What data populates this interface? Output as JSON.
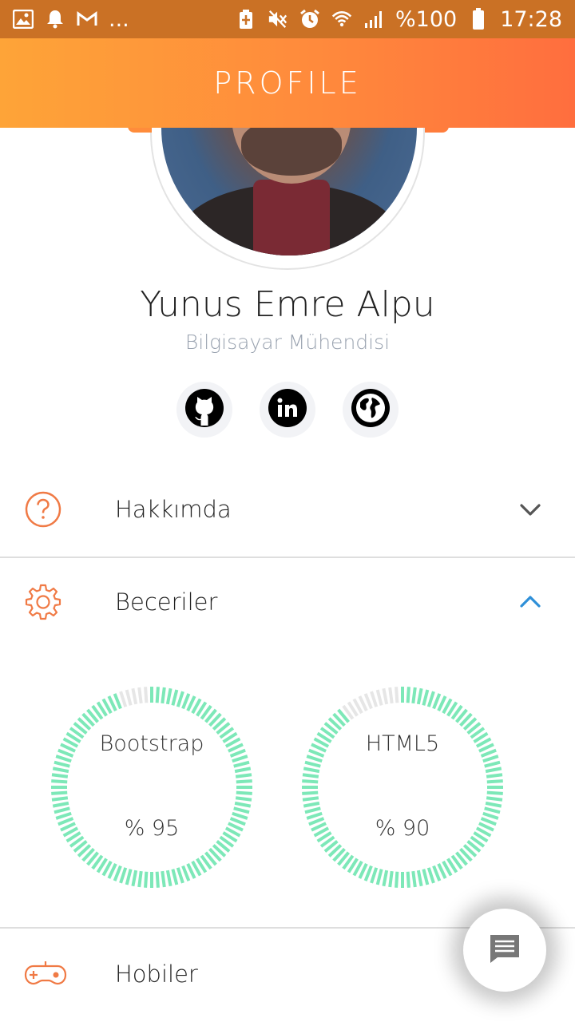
{
  "status_bar": {
    "battery_text": "%100",
    "time": "17:28",
    "left_icons": [
      "image-icon",
      "bell-icon",
      "gmail-icon",
      "more-dots-icon"
    ],
    "right_icons": [
      "battery-saver-icon",
      "mute-icon",
      "alarm-icon",
      "wifi-icon",
      "signal-icon",
      "battery-icon"
    ],
    "more_text": "..."
  },
  "header": {
    "title": "PROFILE"
  },
  "profile": {
    "name": "Yunus Emre Alpu",
    "title": "Bilgisayar Mühendisi"
  },
  "social": [
    {
      "name": "github-icon"
    },
    {
      "name": "linkedin-icon"
    },
    {
      "name": "globe-icon"
    }
  ],
  "sections": {
    "about": {
      "label": "Hakkımda",
      "expanded": false
    },
    "skills": {
      "label": "Beceriler",
      "expanded": true,
      "items": [
        {
          "name": "Bootstrap",
          "value_text": "% 95",
          "percent": 95
        },
        {
          "name": "HTML5",
          "value_text": "% 90",
          "percent": 90
        }
      ]
    },
    "hobbies": {
      "label": "Hobiler",
      "expanded": false
    }
  },
  "colors": {
    "header_start": "#fea438",
    "header_end": "#ff6e3e",
    "status_bar": "#ca7125",
    "accent_icon": "#f07a45",
    "skill_ring": "#7de8b8",
    "skill_ring_empty": "#e6e6e6",
    "chevron_active": "#2e8fd8",
    "chevron": "#555555"
  }
}
